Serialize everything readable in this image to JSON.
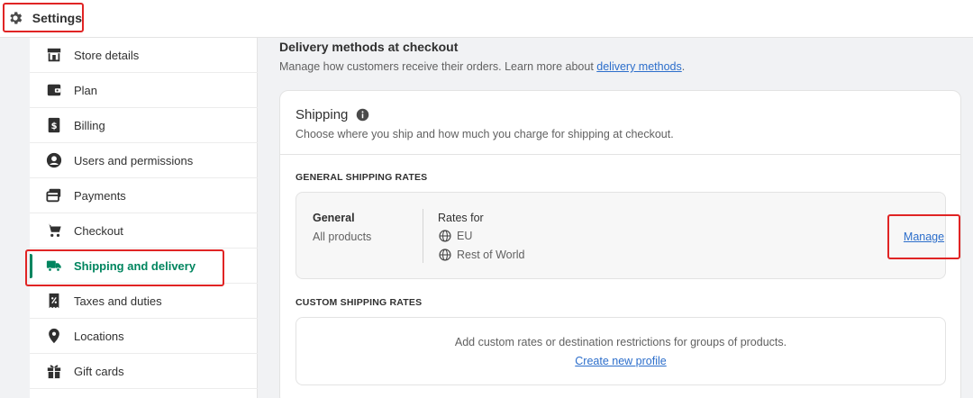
{
  "header": {
    "title": "Settings",
    "icon": "gear-icon"
  },
  "sidebar": {
    "active_color": "#00855f",
    "items": [
      {
        "label": "Store details",
        "icon": "store-icon"
      },
      {
        "label": "Plan",
        "icon": "plan-icon"
      },
      {
        "label": "Billing",
        "icon": "billing-icon"
      },
      {
        "label": "Users and permissions",
        "icon": "user-icon"
      },
      {
        "label": "Payments",
        "icon": "payments-icon"
      },
      {
        "label": "Checkout",
        "icon": "cart-icon"
      },
      {
        "label": "Shipping and delivery",
        "icon": "truck-icon",
        "active": true
      },
      {
        "label": "Taxes and duties",
        "icon": "taxes-icon"
      },
      {
        "label": "Locations",
        "icon": "location-pin-icon"
      },
      {
        "label": "Gift cards",
        "icon": "gift-icon"
      }
    ]
  },
  "main": {
    "section_title": "Delivery methods at checkout",
    "section_desc": "Manage how customers receive their orders. Learn more about ",
    "section_link": "delivery methods",
    "section_desc_end": ".",
    "card": {
      "title": "Shipping",
      "info_icon": "info-icon",
      "description": "Choose where you ship and how much you charge for shipping at checkout.",
      "general_heading": "GENERAL SHIPPING RATES",
      "general": {
        "name": "General",
        "sub": "All products",
        "rates_label": "Rates for",
        "zones": [
          "EU",
          "Rest of World"
        ],
        "manage_label": "Manage"
      },
      "custom_heading": "CUSTOM SHIPPING RATES",
      "custom": {
        "text": "Add custom rates or destination restrictions for groups of products.",
        "link": "Create new profile"
      }
    }
  }
}
